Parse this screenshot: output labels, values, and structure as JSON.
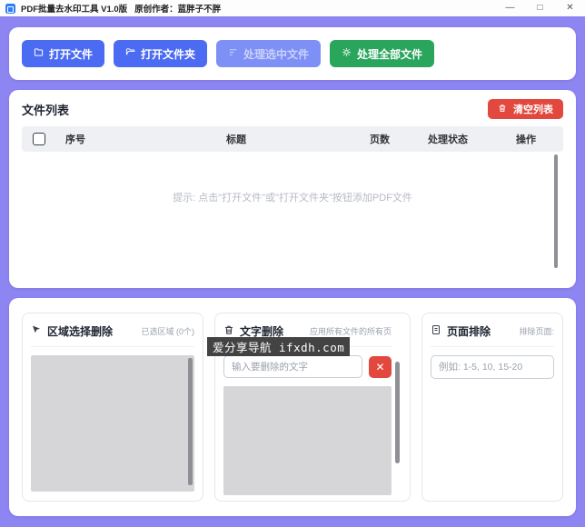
{
  "window": {
    "title": "PDF批量去水印工具 V1.0版   原创作者：蓝胖子不胖",
    "controls": {
      "minimize": "—",
      "maximize": "□",
      "close": "✕"
    }
  },
  "toolbar": {
    "buttons": [
      {
        "label": "打开文件",
        "icon": "folder-icon"
      },
      {
        "label": "打开文件夹",
        "icon": "folder-open-icon"
      },
      {
        "label": "处理选中文件",
        "icon": "process-selected-icon",
        "state": "disabled"
      },
      {
        "label": "处理全部文件",
        "icon": "process-all-icon",
        "state": "enabled"
      }
    ]
  },
  "file_list": {
    "title": "文件列表",
    "clear_button_label": "清空列表",
    "columns": [
      "序号",
      "标题",
      "页数",
      "处理状态",
      "操作"
    ],
    "empty_hint": "提示: 点击\"打开文件\"或\"打开文件夹\"按钮添加PDF文件"
  },
  "panels": {
    "area_select": {
      "title": "区域选择删除",
      "note": "已选区域 (0个)"
    },
    "text_delete": {
      "title": "文字删除",
      "note": "应用所有文件的所有页",
      "placeholder": "输入要删除的文字",
      "clear_label": "✕"
    },
    "page_exclude": {
      "title": "页面排除",
      "note": "排除页面:",
      "placeholder": "例如: 1-5, 10, 15-20"
    }
  },
  "watermark": {
    "text": "爱分享导航 ifxdh.com"
  },
  "colors": {
    "background": "#8d85f1",
    "primary": "#4b6bf2",
    "primary_disabled": "#7e8ff5",
    "success": "#2aa55c",
    "danger": "#e2483d"
  }
}
